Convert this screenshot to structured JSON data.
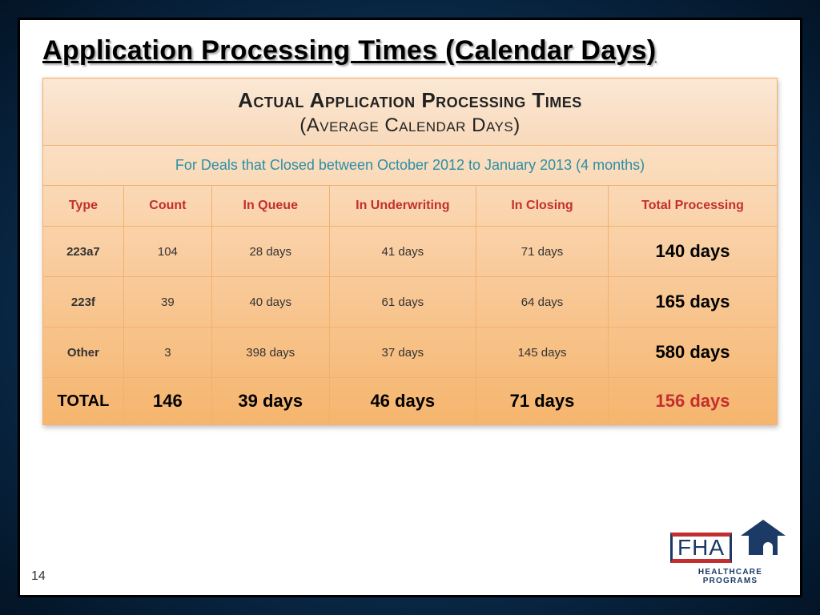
{
  "title": "Application Processing Times (Calendar Days)",
  "table": {
    "header_line1": "Actual Application Processing Times",
    "header_line2": "(Average Calendar Days)",
    "sub_header": "For Deals that Closed between October 2012 to January 2013 (4 months)",
    "columns": [
      "Type",
      "Count",
      "In Queue",
      "In Underwriting",
      "In Closing",
      "Total Processing"
    ],
    "rows": [
      {
        "type": "223a7",
        "count": "104",
        "queue": "28 days",
        "underwriting": "41 days",
        "closing": "71 days",
        "total": "140 days"
      },
      {
        "type": "223f",
        "count": "39",
        "queue": "40 days",
        "underwriting": "61 days",
        "closing": "64 days",
        "total": "165 days"
      },
      {
        "type": "Other",
        "count": "3",
        "queue": "398 days",
        "underwriting": "37 days",
        "closing": "145 days",
        "total": "580 days"
      }
    ],
    "total_row": {
      "type": "TOTAL",
      "count": "146",
      "queue": "39 days",
      "underwriting": "46 days",
      "closing": "71 days",
      "total": "156 days"
    }
  },
  "page_number": "14",
  "logo": {
    "acronym": "FHA",
    "subtitle": "HEALTHCARE PROGRAMS"
  },
  "chart_data": {
    "type": "table",
    "title": "Actual Application Processing Times (Average Calendar Days)",
    "note": "For Deals that Closed between October 2012 to January 2013 (4 months)",
    "columns": [
      "Type",
      "Count",
      "In Queue (days)",
      "In Underwriting (days)",
      "In Closing (days)",
      "Total Processing (days)"
    ],
    "rows": [
      [
        "223a7",
        104,
        28,
        41,
        71,
        140
      ],
      [
        "223f",
        39,
        40,
        61,
        64,
        165
      ],
      [
        "Other",
        3,
        398,
        37,
        145,
        580
      ],
      [
        "TOTAL",
        146,
        39,
        46,
        71,
        156
      ]
    ]
  }
}
